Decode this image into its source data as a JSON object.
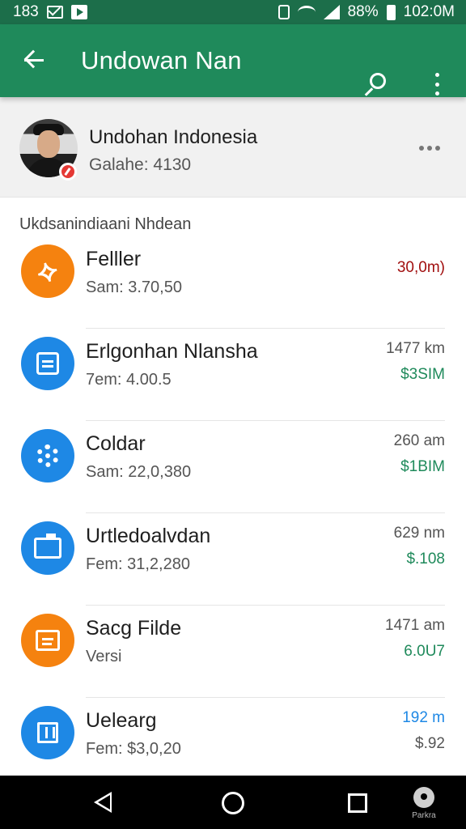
{
  "status_bar": {
    "time_left": "183",
    "battery_percent": "88%",
    "time_right": "102:0M"
  },
  "app_bar": {
    "title": "Undowan Nan"
  },
  "account": {
    "name": "Undohan Indonesia",
    "subtitle": "Galahe: 4130"
  },
  "section": {
    "label": "Ukdsanindiaani Nhdean"
  },
  "items": [
    {
      "title": "Felller",
      "subtitle": "Sam: 3.70,50",
      "meta": "",
      "value": "30,0m)",
      "value_color": "#a10f0f",
      "icon": "orange-fingerprint-icon",
      "icon_bg": "orange"
    },
    {
      "title": "Erlgonhan Nlansha",
      "subtitle": "7em: 4.00.5",
      "meta": "1477 km",
      "value": "$3SIM",
      "value_color": "#1f8a5b",
      "icon": "clipboard-icon",
      "icon_bg": "blue"
    },
    {
      "title": "Coldar",
      "subtitle": "Sam: 22,0,380",
      "meta": "260 am",
      "value": "$1BIM",
      "value_color": "#1f8a5b",
      "icon": "gear-icon",
      "icon_bg": "blue"
    },
    {
      "title": "Urtledoalvdan",
      "subtitle": "Fem: 31,2,280",
      "meta": "629 nm",
      "value": "$.108",
      "value_color": "#1f8a5b",
      "icon": "folder-icon",
      "icon_bg": "blue"
    },
    {
      "title": "Sacg Filde",
      "subtitle": "Versi",
      "meta": "1471 am",
      "value": "6.0U7",
      "value_color": "#1f8a5b",
      "icon": "printer-icon",
      "icon_bg": "orange"
    },
    {
      "title": "Uelearg",
      "subtitle": "Fem: $3,0,20",
      "meta": "192 m",
      "value": "$.92",
      "value_color": "#555555",
      "icon": "home-icon",
      "icon_bg": "blue",
      "meta_color": "#1e88e5"
    }
  ],
  "nav_bar": {
    "extra_label": "Parkra"
  }
}
